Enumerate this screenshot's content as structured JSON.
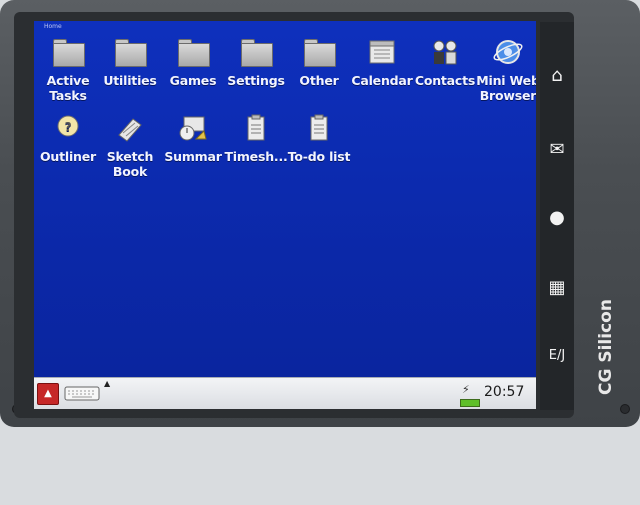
{
  "screen": {
    "title": "Home",
    "apps": [
      {
        "label": "Active Tasks",
        "icon": "folder-icon"
      },
      {
        "label": "Utilities",
        "icon": "folder-icon"
      },
      {
        "label": "Games",
        "icon": "folder-icon"
      },
      {
        "label": "Settings",
        "icon": "folder-icon"
      },
      {
        "label": "Other",
        "icon": "folder-icon"
      },
      {
        "label": "Calendar",
        "icon": "calendar-icon"
      },
      {
        "label": "Contacts",
        "icon": "contacts-icon"
      },
      {
        "label": "Mini Web Browser",
        "icon": "web-browser-icon"
      },
      {
        "label": "Outliner",
        "icon": "outliner-icon"
      },
      {
        "label": "Sketch Book",
        "icon": "sketchbook-icon"
      },
      {
        "label": "Summar",
        "icon": "summary-icon"
      },
      {
        "label": "Timesh...",
        "icon": "timesheet-icon"
      },
      {
        "label": "To-do list",
        "icon": "todo-icon"
      }
    ]
  },
  "taskbar": {
    "clock": "20:57",
    "start_icon": "home-icon",
    "keyboard_icon": "keyboard-icon",
    "power_icon": "plug-icon",
    "battery_icon": "battery-icon"
  },
  "hardware": {
    "brand": "CG Silicon",
    "side_buttons": [
      "home-key-icon",
      "mail-key-icon",
      "contacts-key-icon",
      "calculator-key-icon",
      "language-key-icon"
    ],
    "language_label": "E/J"
  },
  "colors": {
    "desktop": "#0b28a8",
    "taskbar": "#e6e8ec",
    "start_button": "#c62828"
  }
}
